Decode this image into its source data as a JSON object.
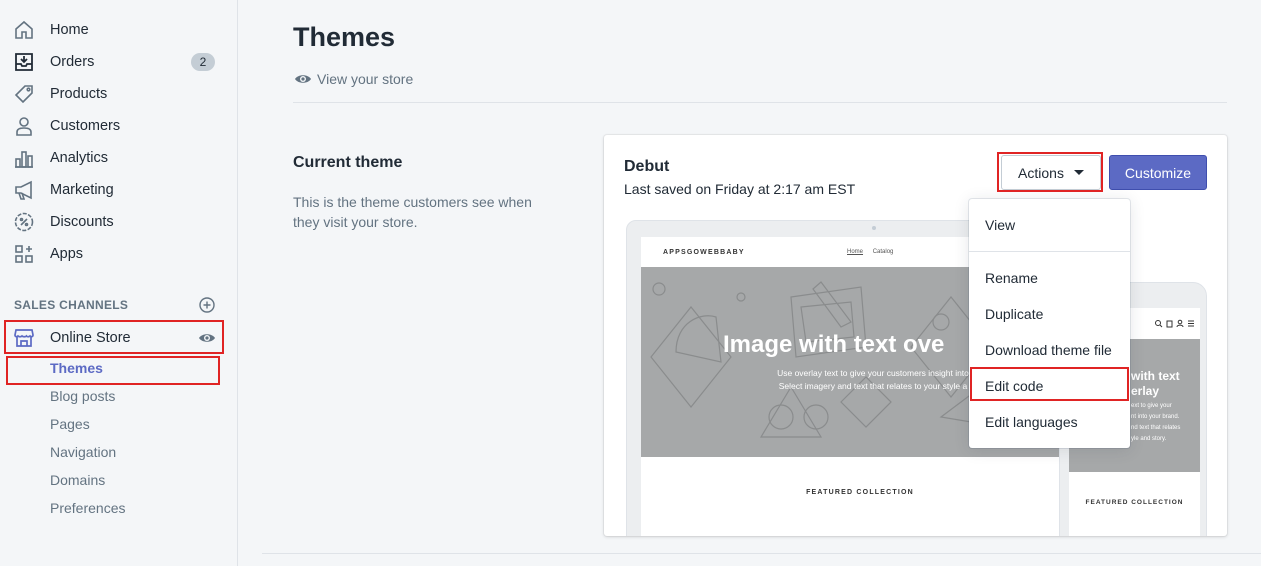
{
  "sidebar": {
    "items": [
      {
        "label": "Home",
        "icon": "home-icon"
      },
      {
        "label": "Orders",
        "icon": "orders-icon",
        "badge": "2"
      },
      {
        "label": "Products",
        "icon": "tag-icon"
      },
      {
        "label": "Customers",
        "icon": "person-icon"
      },
      {
        "label": "Analytics",
        "icon": "bar-chart-icon"
      },
      {
        "label": "Marketing",
        "icon": "megaphone-icon"
      },
      {
        "label": "Discounts",
        "icon": "discount-icon"
      },
      {
        "label": "Apps",
        "icon": "apps-icon"
      }
    ],
    "sales_channels_heading": "SALES CHANNELS",
    "online_store": "Online Store",
    "sub_items": [
      "Themes",
      "Blog posts",
      "Pages",
      "Navigation",
      "Domains",
      "Preferences"
    ]
  },
  "main": {
    "title": "Themes",
    "view_store": "View your store",
    "current_theme_title": "Current theme",
    "current_theme_desc": "This is the theme customers see when they visit your store."
  },
  "theme": {
    "name": "Debut",
    "last_saved": "Last saved on Friday at 2:17 am EST",
    "actions_label": "Actions",
    "customize_label": "Customize"
  },
  "preview": {
    "logo": "APPSGOWEBBABY",
    "nav_home": "Home",
    "nav_catalog": "Catalog",
    "hero_title": "Image with text ove",
    "hero_sub1": "Use overlay text to give your customers insight into",
    "hero_sub2": "Select imagery and text that relates to your style a",
    "featured": "FEATURED COLLECTION",
    "phone_title1": "with text",
    "phone_title2": "erlay",
    "phone_sub1": "ext to give your",
    "phone_sub2": "nt into your brand.",
    "phone_sub3": "nd text that relates",
    "phone_sub4": "yle and story.",
    "phone_featured": "FEATURED COLLECTION"
  },
  "dropdown": {
    "items": [
      "View",
      "Rename",
      "Duplicate",
      "Download theme file",
      "Edit code",
      "Edit languages"
    ]
  },
  "colors": {
    "accent": "#5c6ac4",
    "highlight": "#e02424"
  }
}
